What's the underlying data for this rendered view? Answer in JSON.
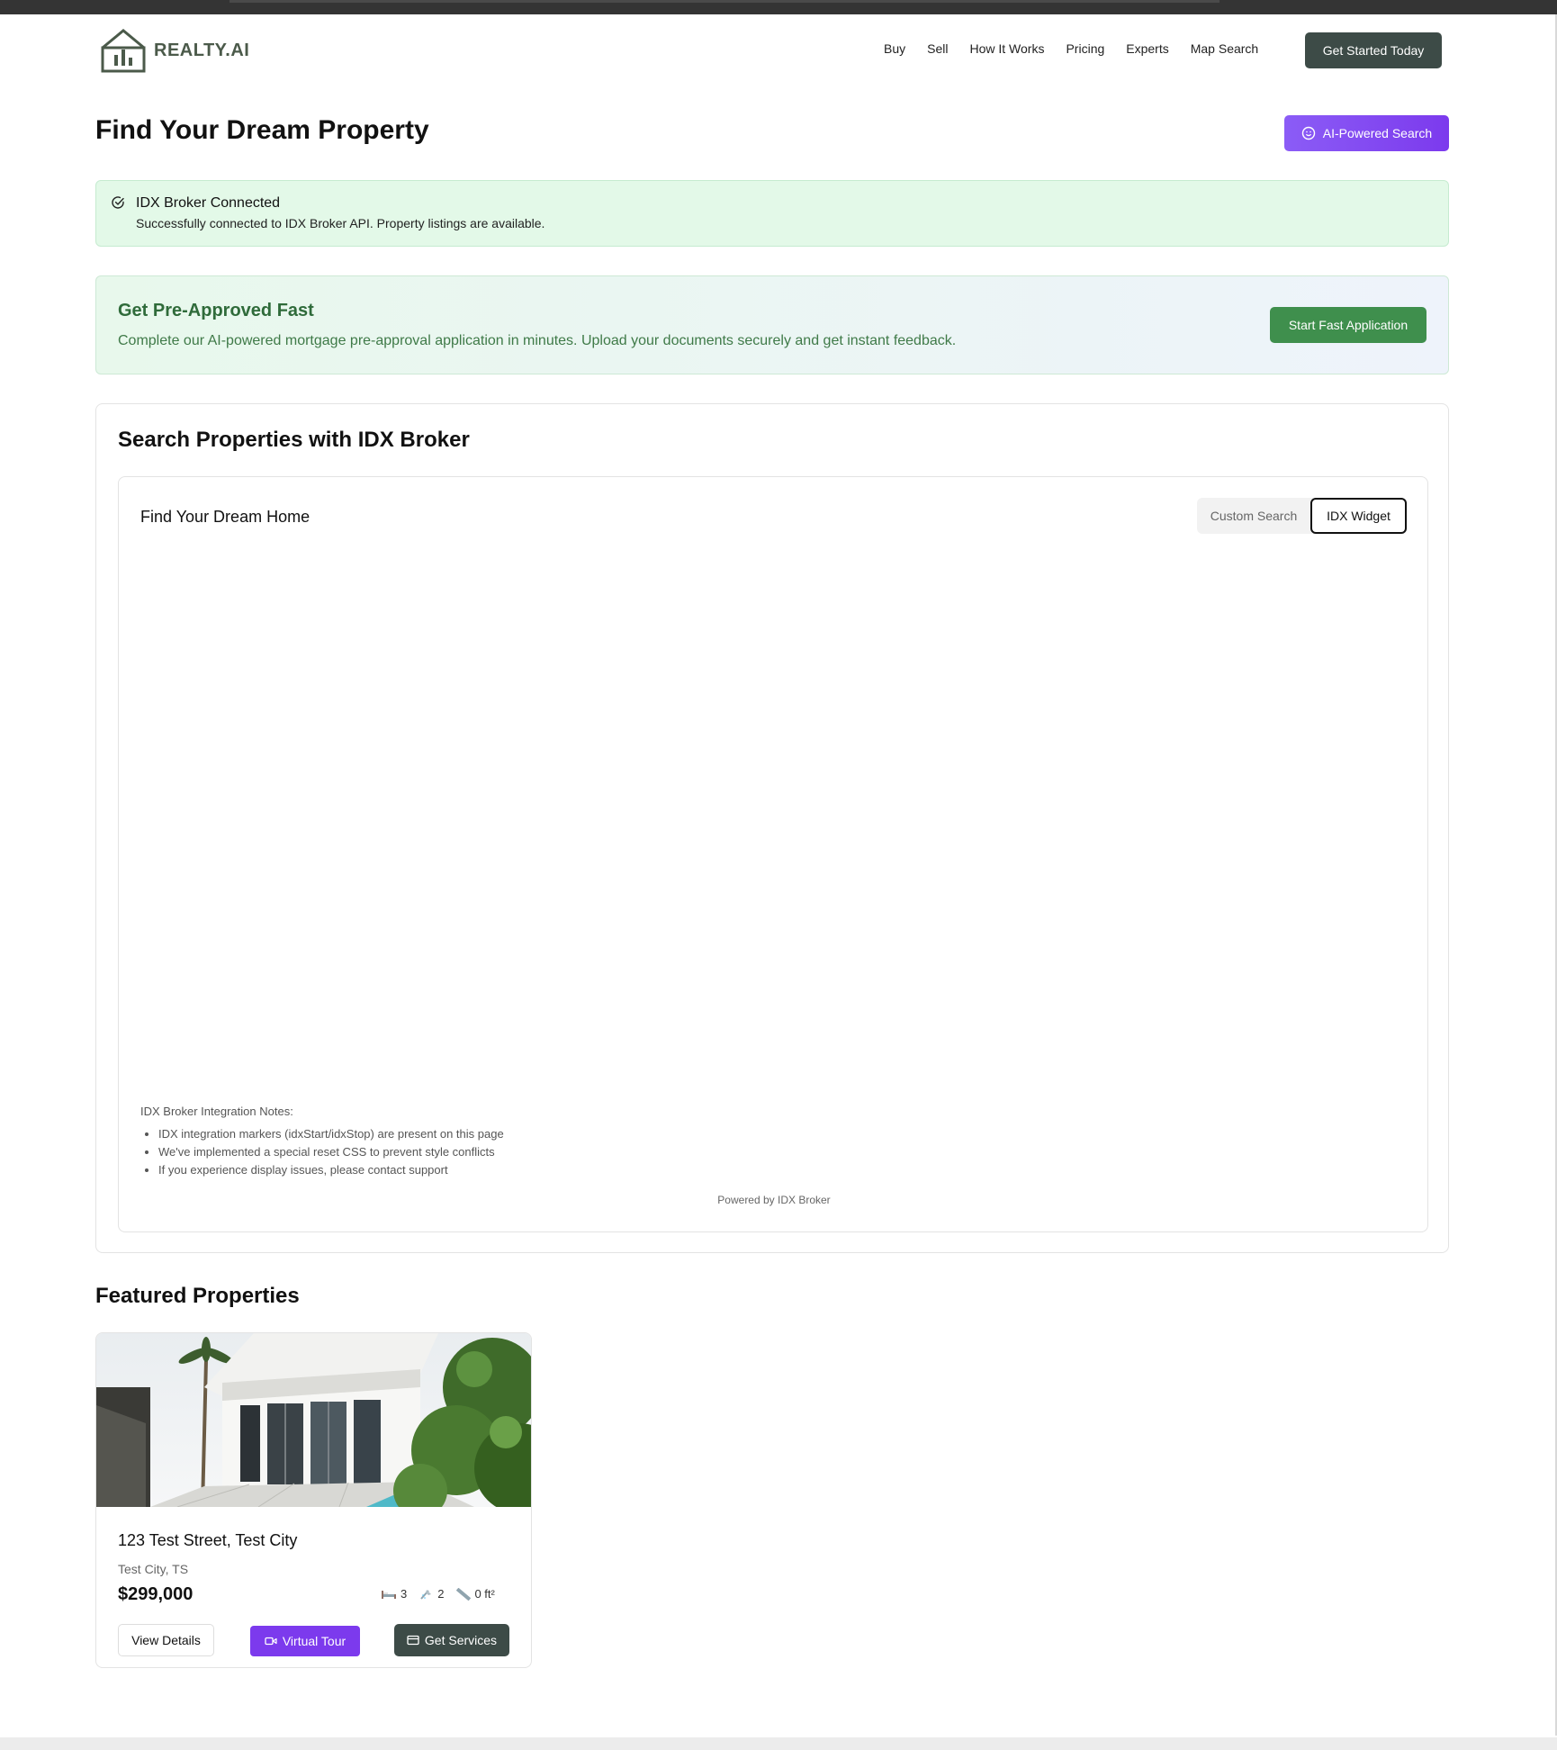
{
  "brand": {
    "name": "REALTY.AI"
  },
  "nav": {
    "links": [
      "Buy",
      "Sell",
      "How It Works",
      "Pricing",
      "Experts",
      "Map Search"
    ],
    "cta": "Get Started Today"
  },
  "header": {
    "title": "Find Your Dream Property",
    "ai_button": "AI-Powered Search"
  },
  "alert": {
    "title": "IDX Broker Connected",
    "message": "Successfully connected to IDX Broker API. Property listings are available."
  },
  "preapproval": {
    "title": "Get Pre-Approved Fast",
    "description": "Complete our AI-powered mortgage pre-approval application in minutes. Upload your documents securely and get instant feedback.",
    "button": "Start Fast Application"
  },
  "search": {
    "title": "Search Properties with IDX Broker",
    "inner_title": "Find Your Dream Home",
    "tabs": {
      "custom": "Custom Search",
      "idx": "IDX Widget",
      "active": "IDX Widget"
    },
    "notes_title": "IDX Broker Integration Notes:",
    "notes": [
      "IDX integration markers (idxStart/idxStop) are present on this page",
      "We've implemented a special reset CSS to prevent style conflicts",
      "If you experience display issues, please contact support"
    ],
    "powered_by": "Powered by IDX Broker"
  },
  "featured": {
    "title": "Featured Properties",
    "properties": [
      {
        "address": "123 Test Street, Test City",
        "city": "Test City, TS",
        "price": "$299,000",
        "beds": "3",
        "baths": "2",
        "sqft": "0 ft²",
        "buttons": {
          "details": "View Details",
          "tour": "Virtual Tour",
          "services": "Get Services"
        }
      }
    ]
  },
  "colors": {
    "primary_dark": "#3d4b47",
    "purple": "#7c3aed",
    "green": "#3f8f4d",
    "alert_bg": "#e3f9e8"
  }
}
